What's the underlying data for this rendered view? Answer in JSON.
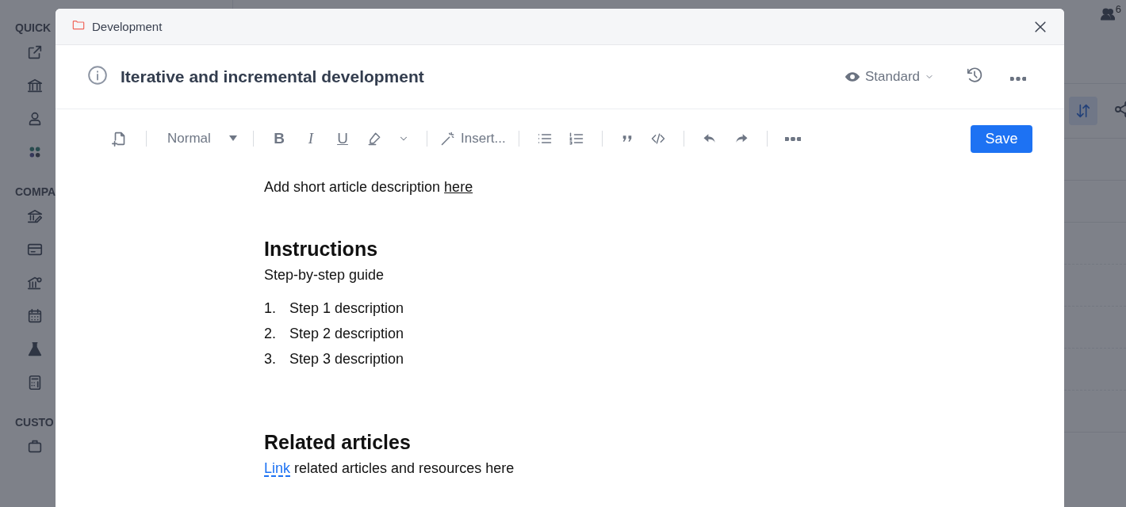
{
  "sidebar": {
    "sections": [
      {
        "heading": "QUICK"
      },
      {
        "heading": "COMPA"
      },
      {
        "heading": "CUSTO"
      }
    ]
  },
  "topbar": {
    "members_count": "6"
  },
  "modal": {
    "breadcrumb": "Development",
    "title": "Iterative and incremental development",
    "view_select": "Standard",
    "toolbar": {
      "style_select": "Normal",
      "format_buttons": [
        "B",
        "I",
        "U"
      ],
      "insert_button": "Insert...",
      "save_button": "Save"
    },
    "content": [
      {
        "kind": "paragraph",
        "segments": [
          {
            "kind": "text",
            "text": "Add short article description "
          },
          {
            "kind": "underlined_link",
            "text": "here"
          }
        ]
      },
      {
        "kind": "heading",
        "text": "Instructions"
      },
      {
        "kind": "paragraph",
        "segments": [
          {
            "kind": "text",
            "text": "Step-by-step guide"
          }
        ]
      },
      {
        "kind": "ordered_list",
        "items": [
          {
            "number": "1.",
            "text": "Step 1 description"
          },
          {
            "number": "2.",
            "text": "Step 2 description"
          },
          {
            "number": "3.",
            "text": "Step 3 description"
          }
        ]
      },
      {
        "kind": "heading",
        "text": "Related articles"
      },
      {
        "kind": "paragraph",
        "segments": [
          {
            "kind": "link",
            "text": "Link"
          },
          {
            "kind": "text",
            "text": " related articles and resources here"
          }
        ]
      }
    ]
  }
}
